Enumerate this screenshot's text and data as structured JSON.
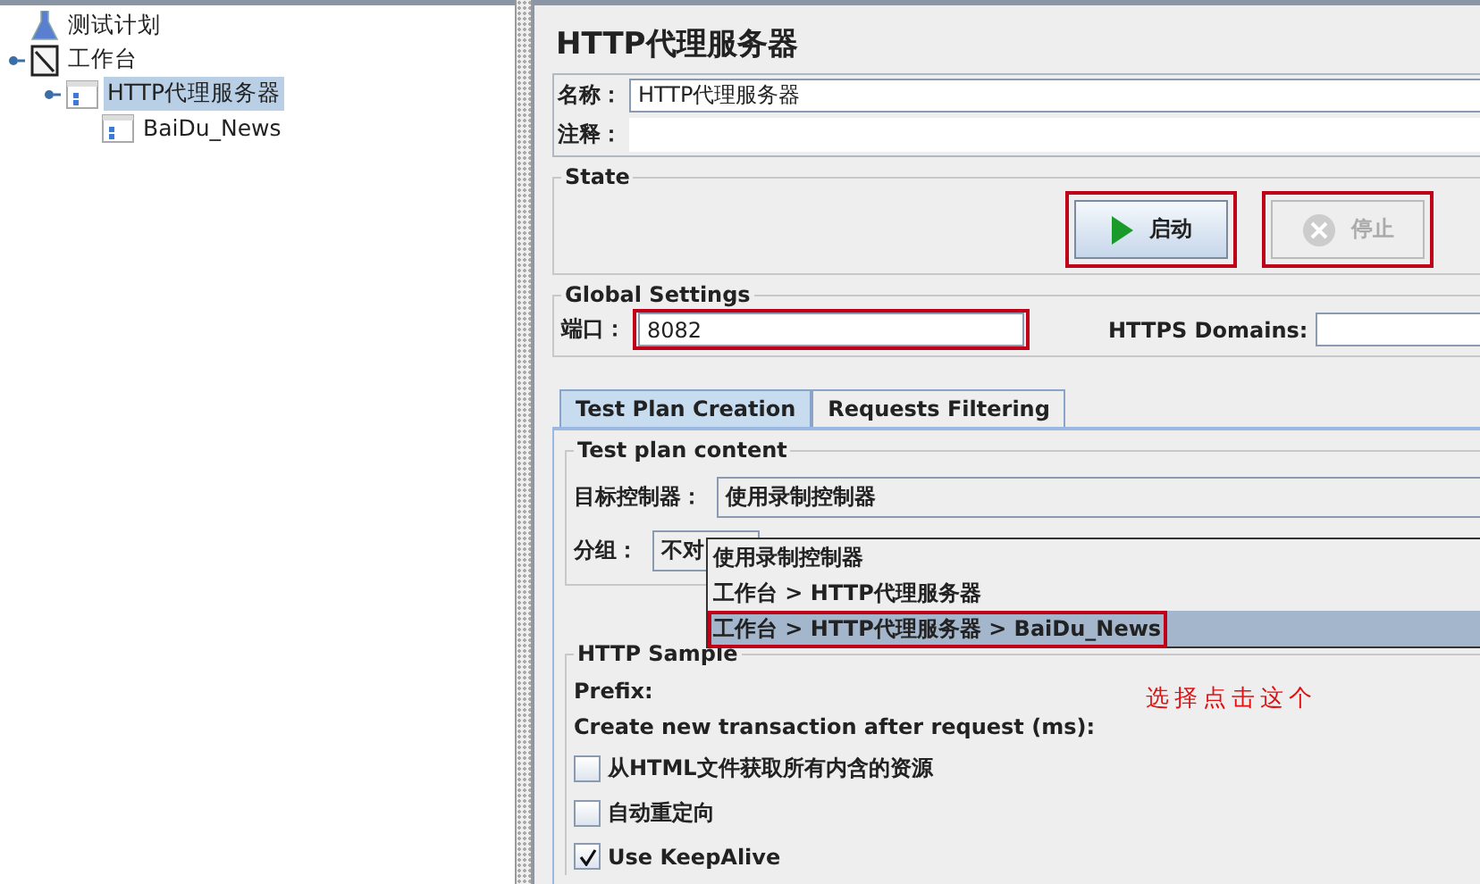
{
  "tree": [
    {
      "label": "测试计划",
      "kind": "plan",
      "selected": false
    },
    {
      "label": "工作台",
      "kind": "workbench",
      "selected": false,
      "children": [
        {
          "label": "HTTP代理服务器",
          "kind": "proxy",
          "selected": true,
          "children": [
            {
              "label": "BaiDu_News",
              "kind": "controller",
              "selected": false
            }
          ]
        }
      ]
    }
  ],
  "title": "HTTP代理服务器",
  "name": {
    "label": "名称：",
    "value": "HTTP代理服务器"
  },
  "comment": {
    "label": "注释："
  },
  "state": {
    "legend": "State",
    "buttons": [
      {
        "label": "启动",
        "kind": "start",
        "disabled": false,
        "highlighted": true
      },
      {
        "label": "停止",
        "kind": "stop",
        "disabled": true,
        "highlighted": true
      }
    ]
  },
  "global": {
    "legend": "Global Settings",
    "port": {
      "label": "端口：",
      "value": "8082",
      "highlighted": true
    },
    "https": {
      "label": "HTTPS Domains:"
    }
  },
  "tabs": [
    {
      "label": "Test Plan Creation",
      "selected": true
    },
    {
      "label": "Requests Filtering",
      "selected": false
    }
  ],
  "content": {
    "legend": "Test plan content",
    "target": {
      "label": "目标控制器：",
      "value": "使用录制控制器"
    },
    "group": {
      "label": "分组：",
      "value": "不对"
    }
  },
  "dropdown": {
    "options": [
      {
        "label": "使用录制控制器",
        "selected": false,
        "highlighted": false
      },
      {
        "label": "工作台 > HTTP代理服务器",
        "selected": false,
        "highlighted": false
      },
      {
        "label": "工作台 > HTTP代理服务器 > BaiDu_News",
        "selected": true,
        "highlighted": true
      }
    ]
  },
  "sampler": {
    "legend": "HTTP Sample",
    "prefix_label": "Prefix:",
    "transaction_label": "Create new transaction after request (ms):",
    "checkboxes": [
      {
        "label": "从HTML文件获取所有内含的资源",
        "checked": false
      },
      {
        "label": "自动重定向",
        "checked": false
      },
      {
        "label": "Use KeepAlive",
        "checked": true
      }
    ]
  },
  "annotation": "选择点击这个"
}
